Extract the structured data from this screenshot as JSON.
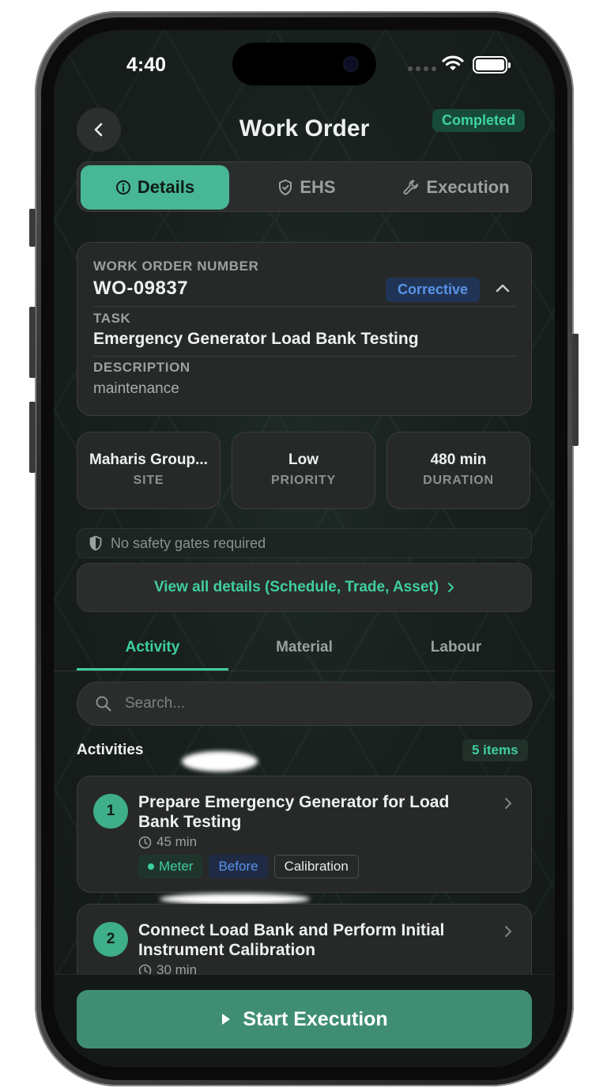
{
  "status_bar": {
    "time": "4:40"
  },
  "header": {
    "title": "Work Order",
    "status": "Completed"
  },
  "segments": [
    {
      "label": "Details",
      "icon": "info-icon",
      "active": true
    },
    {
      "label": "EHS",
      "icon": "shield-check-icon",
      "active": false
    },
    {
      "label": "Execution",
      "icon": "wrench-icon",
      "active": false
    }
  ],
  "work_order": {
    "number_label": "WORK ORDER NUMBER",
    "number": "WO-09837",
    "type": "Corrective",
    "task_label": "TASK",
    "task": "Emergency Generator Load Bank Testing",
    "description_label": "DESCRIPTION",
    "description": "maintenance"
  },
  "stats": [
    {
      "value": "Maharis Group...",
      "label": "SITE"
    },
    {
      "value": "Low",
      "label": "PRIORITY"
    },
    {
      "value": "480 min",
      "label": "DURATION"
    }
  ],
  "safety": {
    "text": "No safety gates required"
  },
  "view_all": {
    "label": "View all details (Schedule, Trade, Asset)"
  },
  "tabs": [
    {
      "label": "Activity",
      "active": true
    },
    {
      "label": "Material",
      "active": false
    },
    {
      "label": "Labour",
      "active": false
    }
  ],
  "search": {
    "placeholder": "Search..."
  },
  "activities_section": {
    "title": "Activities",
    "count": "5 items"
  },
  "activities": [
    {
      "number": "1",
      "title": "Prepare Emergency Generator for Load Bank Testing",
      "duration": "45 min",
      "tags": [
        "Meter",
        "Before",
        "Calibration"
      ]
    },
    {
      "number": "2",
      "title": "Connect Load Bank and Perform Initial Instrument Calibration",
      "duration": "30 min",
      "tags": []
    }
  ],
  "cta": {
    "label": "Start Execution"
  },
  "colors": {
    "accent": "#3fcf9f",
    "primary_button": "#3f8e74",
    "active_segment": "#48b796",
    "corrective": "#5a93e8"
  }
}
